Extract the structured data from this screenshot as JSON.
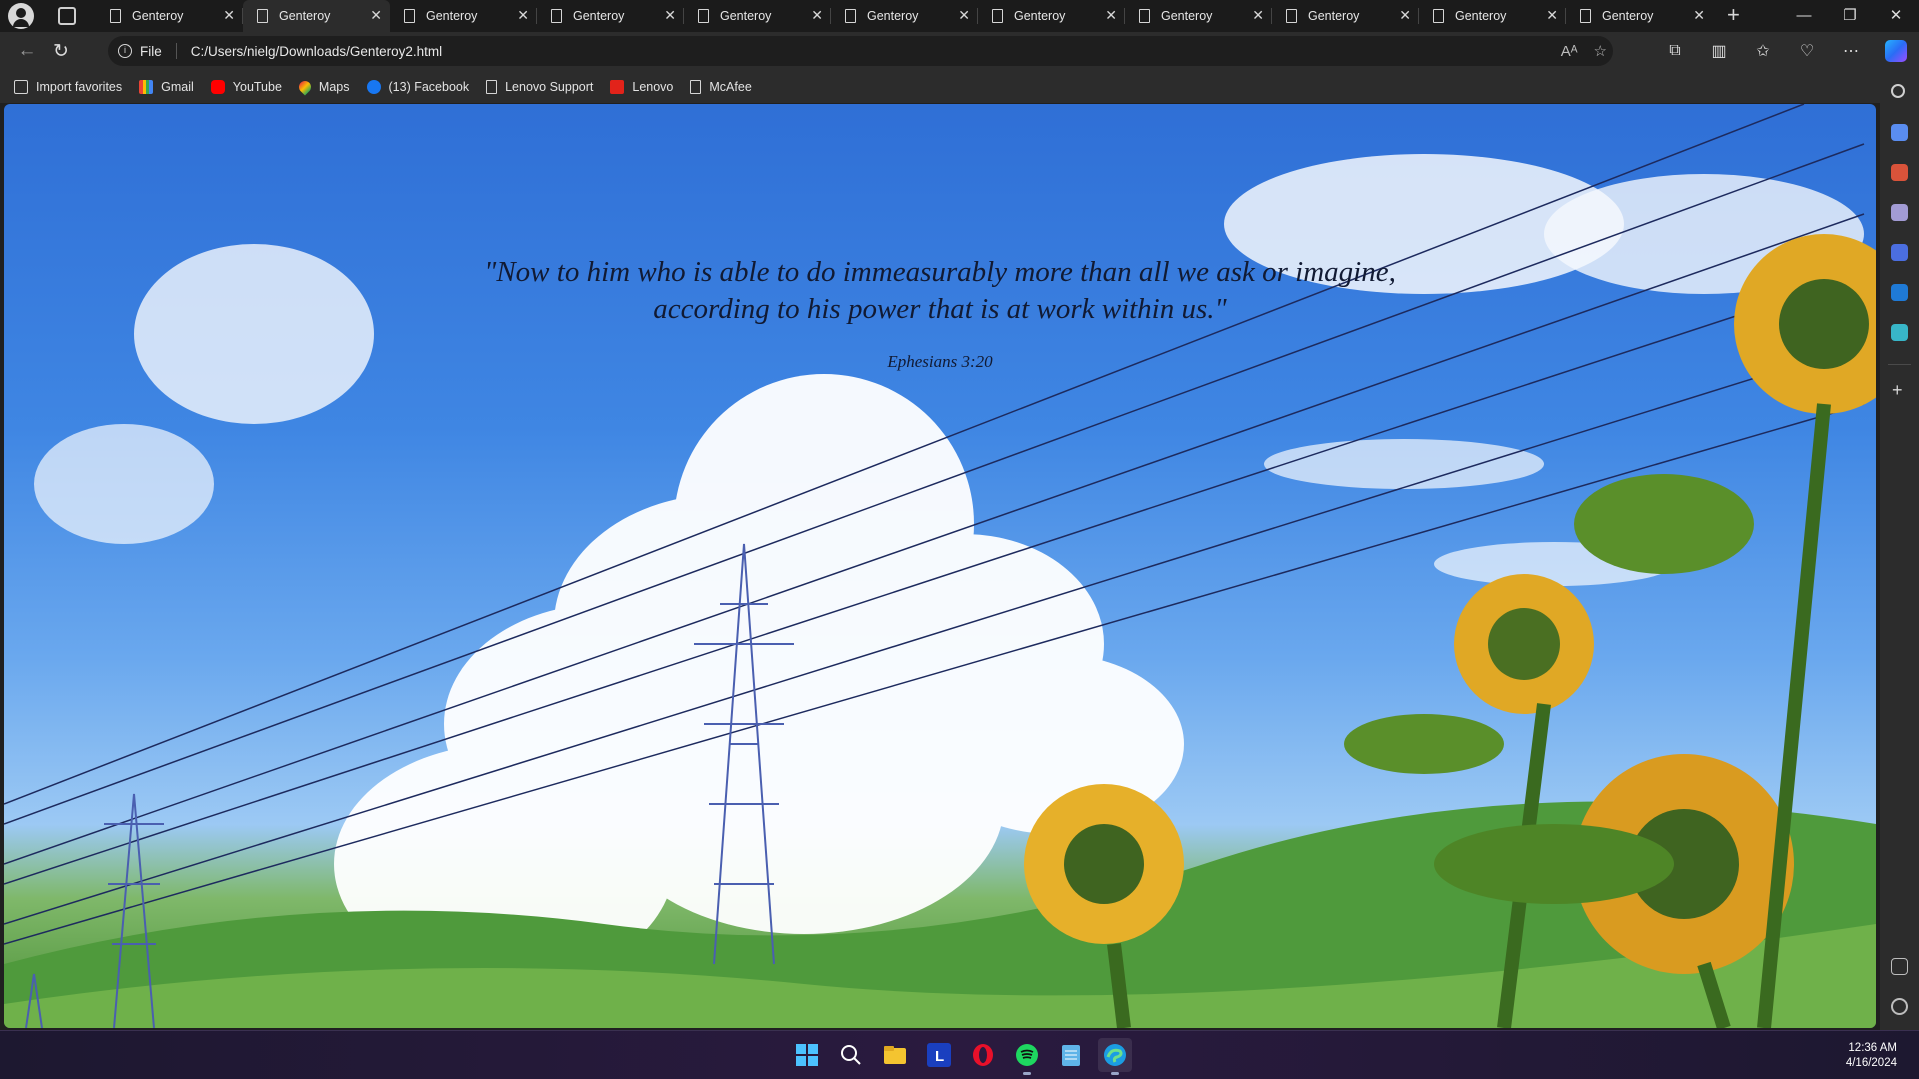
{
  "browser": {
    "tabs": [
      {
        "label": "Genteroy",
        "active": false
      },
      {
        "label": "Genteroy",
        "active": true
      },
      {
        "label": "Genteroy",
        "active": false
      },
      {
        "label": "Genteroy",
        "active": false
      },
      {
        "label": "Genteroy",
        "active": false
      },
      {
        "label": "Genteroy",
        "active": false
      },
      {
        "label": "Genteroy",
        "active": false
      },
      {
        "label": "Genteroy",
        "active": false
      },
      {
        "label": "Genteroy",
        "active": false
      },
      {
        "label": "Genteroy",
        "active": false
      },
      {
        "label": "Genteroy",
        "active": false
      }
    ],
    "address": {
      "scheme_label": "File",
      "url": "C:/Users/nielg/Downloads/Genteroy2.html"
    },
    "favorites": [
      {
        "label": "Import favorites",
        "icon": "import-icon"
      },
      {
        "label": "Gmail",
        "icon": "gmail-icon"
      },
      {
        "label": "YouTube",
        "icon": "youtube-icon"
      },
      {
        "label": "Maps",
        "icon": "maps-icon"
      },
      {
        "label": "(13) Facebook",
        "icon": "facebook-icon"
      },
      {
        "label": "Lenovo Support",
        "icon": "page-icon"
      },
      {
        "label": "Lenovo",
        "icon": "lenovo-icon"
      },
      {
        "label": "McAfee",
        "icon": "page-icon"
      }
    ]
  },
  "page": {
    "quote_line1": "\"Now to him who is able to do immeasurably more than all we ask or imagine,",
    "quote_line2": "according to his power that is at work within us.\"",
    "reference": "Ephesians 3:20"
  },
  "taskbar": {
    "time": "12:36 AM",
    "date": "4/16/2024",
    "apps": [
      "start-icon",
      "search-icon",
      "file-explorer-icon",
      "lenovo-vantage-icon",
      "opera-icon",
      "spotify-icon",
      "notepad-icon",
      "edge-icon"
    ]
  },
  "colors": {
    "accent_edge": "#2a6cf5",
    "quote_text": "#111a33"
  }
}
